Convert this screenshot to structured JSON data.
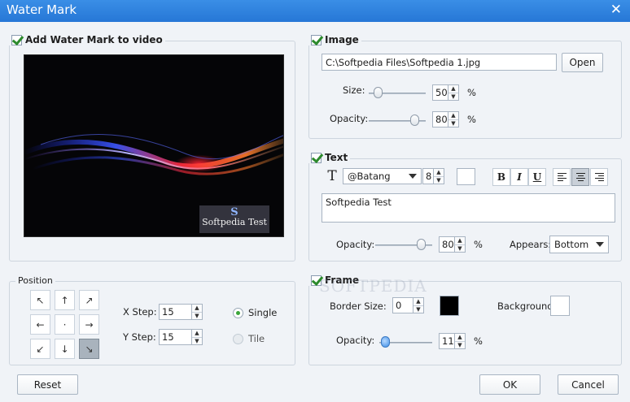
{
  "window": {
    "title": "Water Mark",
    "close_glyph": "✕"
  },
  "left": {
    "add_watermark_label": "Add Water Mark to video",
    "preview_badge_letter": "S",
    "preview_badge_text": "Softpedia Test"
  },
  "position": {
    "label": "Position",
    "grid": [
      "↖",
      "↑",
      "↗",
      "←",
      "·",
      "→",
      "↙",
      "↓",
      "↘"
    ],
    "selected": 8,
    "x_step_label": "X Step:",
    "x_step_value": "15",
    "y_step_label": "Y Step:",
    "y_step_value": "15",
    "single_label": "Single",
    "tile_label": "Tile"
  },
  "image": {
    "label": "Image",
    "path": "C:\\Softpedia Files\\Softpedia 1.jpg",
    "open_label": "Open",
    "size_label": "Size:",
    "size_value": "50",
    "size_fraction": 0.15,
    "opacity_label": "Opacity:",
    "opacity_value": "80",
    "opacity_fraction": 0.8,
    "percent": "%"
  },
  "text": {
    "label": "Text",
    "font_name": "@Batang",
    "font_size": "8",
    "bold": "B",
    "italic": "I",
    "underline": "U",
    "content": "Softpedia Test",
    "opacity_label": "Opacity:",
    "opacity_value": "80",
    "opacity_fraction": 0.8,
    "percent": "%",
    "appears_label": "Appears:",
    "appears_value": "Bottom",
    "align_selected": "center"
  },
  "frame": {
    "label": "Frame",
    "border_size_label": "Border Size:",
    "border_size_value": "0",
    "background_label": "Background:",
    "border_color": "#000000",
    "background_color": "#ffffff",
    "opacity_label": "Opacity:",
    "opacity_value": "11",
    "opacity_fraction": 0.11,
    "percent": "%"
  },
  "footer": {
    "reset_label": "Reset",
    "ok_label": "OK",
    "cancel_label": "Cancel"
  },
  "overlay_watermark": "SOFTPEDIA"
}
